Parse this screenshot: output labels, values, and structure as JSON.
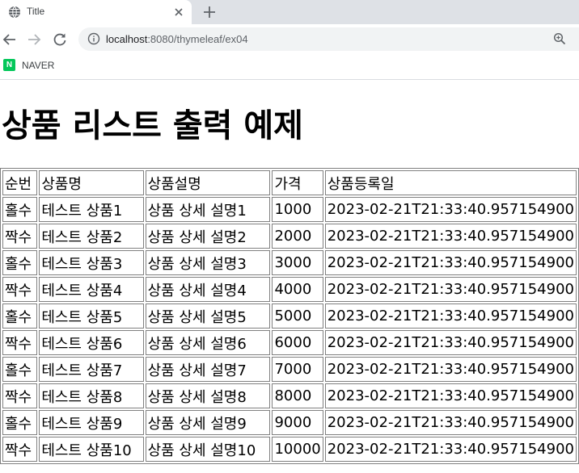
{
  "browser": {
    "tab_title": "Title",
    "url_host": "localhost",
    "url_path": ":8080/thymeleaf/ex04",
    "bookmark_label": "NAVER",
    "bookmark_icon_letter": "N",
    "icons": [
      "globe-icon",
      "close-icon",
      "plus-icon",
      "back-arrow-icon",
      "forward-arrow-icon",
      "reload-icon",
      "info-icon",
      "zoom-icon"
    ]
  },
  "page": {
    "heading": "상품 리스트 출력 예제",
    "table": {
      "headers": [
        "순번",
        "상품명",
        "상품설명",
        "가격",
        "상품등록일"
      ],
      "rows": [
        [
          "홀수",
          "테스트 상품1",
          "상품 상세 설명1",
          "1000",
          "2023-02-21T21:33:40.957154900"
        ],
        [
          "짝수",
          "테스트 상품2",
          "상품 상세 설명2",
          "2000",
          "2023-02-21T21:33:40.957154900"
        ],
        [
          "홀수",
          "테스트 상품3",
          "상품 상세 설명3",
          "3000",
          "2023-02-21T21:33:40.957154900"
        ],
        [
          "짝수",
          "테스트 상품4",
          "상품 상세 설명4",
          "4000",
          "2023-02-21T21:33:40.957154900"
        ],
        [
          "홀수",
          "테스트 상품5",
          "상품 상세 설명5",
          "5000",
          "2023-02-21T21:33:40.957154900"
        ],
        [
          "짝수",
          "테스트 상품6",
          "상품 상세 설명6",
          "6000",
          "2023-02-21T21:33:40.957154900"
        ],
        [
          "홀수",
          "테스트 상품7",
          "상품 상세 설명7",
          "7000",
          "2023-02-21T21:33:40.957154900"
        ],
        [
          "짝수",
          "테스트 상품8",
          "상품 상세 설명8",
          "8000",
          "2023-02-21T21:33:40.957154900"
        ],
        [
          "홀수",
          "테스트 상품9",
          "상품 상세 설명9",
          "9000",
          "2023-02-21T21:33:40.957154900"
        ],
        [
          "짝수",
          "테스트 상품10",
          "상품 상세 설명10",
          "10000",
          "2023-02-21T21:33:40.957154900"
        ]
      ]
    }
  }
}
